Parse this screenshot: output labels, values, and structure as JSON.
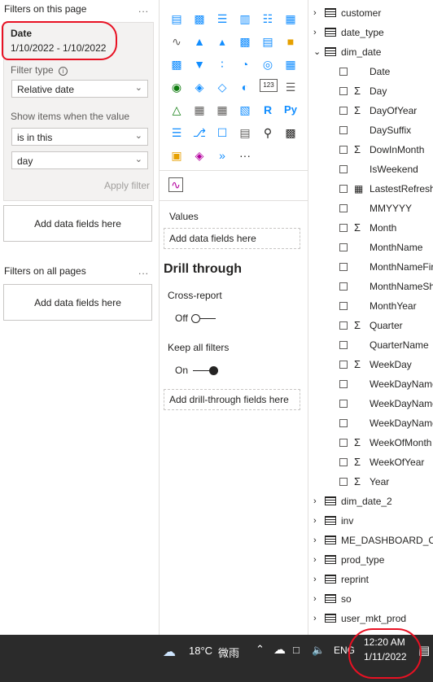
{
  "filters": {
    "page_title": "Filters on this page",
    "more": "...",
    "card": {
      "field": "Date",
      "summary": "1/10/2022 - 1/10/2022",
      "filter_type_label": "Filter type",
      "filter_type_value": "Relative date",
      "show_items_label": "Show items when the value",
      "condition_value": "is in this",
      "unit_value": "day",
      "apply_label": "Apply filter"
    },
    "add_fields": "Add data fields here",
    "all_pages_title": "Filters on all pages",
    "all_pages_add": "Add data fields here"
  },
  "viz": {
    "values_label": "Values",
    "values_placeholder": "Add data fields here",
    "drill_title": "Drill through",
    "cross_report_label": "Cross-report",
    "cross_report_state": "Off",
    "keep_filters_label": "Keep all filters",
    "keep_filters_state": "On",
    "drill_placeholder": "Add drill-through fields here",
    "icon_r": "R",
    "icon_py": "Py",
    "icon_123": "123",
    "icon_more": "···"
  },
  "fields": {
    "tables": [
      {
        "name": "customer"
      },
      {
        "name": "date_type"
      },
      {
        "name": "dim_date"
      }
    ],
    "dim_date_fields": [
      {
        "label": "Date",
        "sigma": false,
        "calc": false
      },
      {
        "label": "Day",
        "sigma": true,
        "calc": false
      },
      {
        "label": "DayOfYear",
        "sigma": true,
        "calc": false
      },
      {
        "label": "DaySuffix",
        "sigma": false,
        "calc": false
      },
      {
        "label": "DowInMonth",
        "sigma": true,
        "calc": false
      },
      {
        "label": "IsWeekend",
        "sigma": false,
        "calc": false
      },
      {
        "label": "LastestRefreshDate",
        "sigma": false,
        "calc": true
      },
      {
        "label": "MMYYYY",
        "sigma": false,
        "calc": false
      },
      {
        "label": "Month",
        "sigma": true,
        "calc": false
      },
      {
        "label": "MonthName",
        "sigma": false,
        "calc": false
      },
      {
        "label": "MonthNameFirstLetter",
        "sigma": false,
        "calc": false
      },
      {
        "label": "MonthNameShort",
        "sigma": false,
        "calc": false
      },
      {
        "label": "MonthYear",
        "sigma": false,
        "calc": false
      },
      {
        "label": "Quarter",
        "sigma": true,
        "calc": false
      },
      {
        "label": "QuarterName",
        "sigma": false,
        "calc": false
      },
      {
        "label": "WeekDay",
        "sigma": true,
        "calc": false
      },
      {
        "label": "WeekDayName",
        "sigma": false,
        "calc": false
      },
      {
        "label": "WeekDayNameFirstLetter",
        "sigma": false,
        "calc": false
      },
      {
        "label": "WeekDayNameShort",
        "sigma": false,
        "calc": false
      },
      {
        "label": "WeekOfMonth",
        "sigma": true,
        "calc": false
      },
      {
        "label": "WeekOfYear",
        "sigma": true,
        "calc": false
      },
      {
        "label": "Year",
        "sigma": true,
        "calc": false
      }
    ],
    "more_tables": [
      {
        "name": "dim_date_2"
      },
      {
        "name": "inv"
      },
      {
        "name": "ME_DASHBOARD_CUST"
      },
      {
        "name": "prod_type"
      },
      {
        "name": "reprint"
      },
      {
        "name": "so"
      },
      {
        "name": "user_mkt_prod"
      }
    ]
  },
  "taskbar": {
    "temperature": "18°C",
    "weather": "微雨",
    "lang": "ENG",
    "time": "12:20 AM",
    "date": "1/11/2022"
  },
  "colors": {
    "accent": "#e81123",
    "taskbar": "#2b2b2b"
  }
}
